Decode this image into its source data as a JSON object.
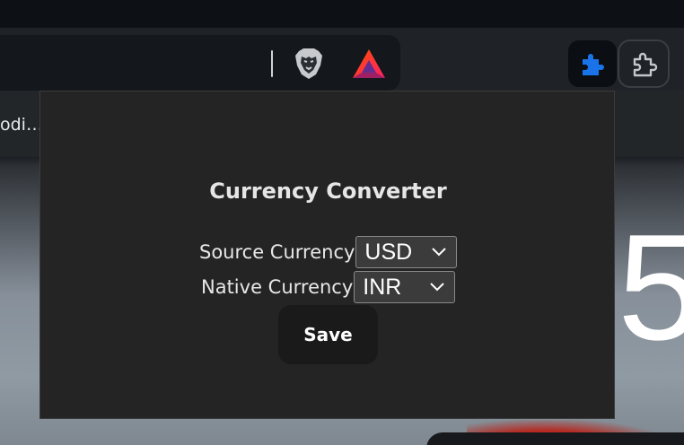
{
  "browser": {
    "bookmark_text": "odi…",
    "omnibox_icons": [
      "brave-shields-icon",
      "brave-rewards-icon"
    ],
    "extension_buttons": [
      "puzzle-extensions-icon",
      "extension-outline-icon"
    ]
  },
  "background": {
    "clock_digit": "5"
  },
  "popup": {
    "title": "Currency Converter",
    "source": {
      "label": "Source Currency",
      "selected": "USD"
    },
    "native": {
      "label": "Native Currency",
      "selected": "INR"
    },
    "save_label": "Save"
  },
  "colors": {
    "popup_bg": "#242424",
    "accent_blue": "#1a73e8",
    "select_bg": "#3b3b3b"
  }
}
